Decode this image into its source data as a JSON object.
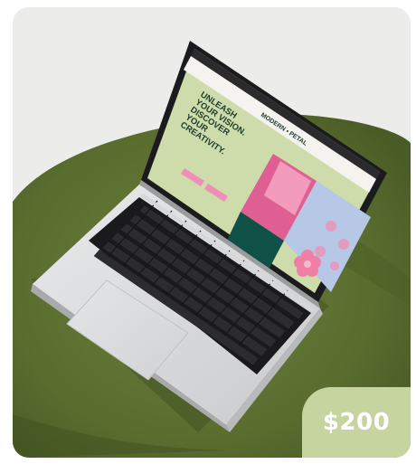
{
  "listing": {
    "price": "$200"
  },
  "website": {
    "brand": "MODERN • PETAL",
    "headline": [
      "UNLEASH",
      "YOUR VISION.",
      "DISCOVER",
      "YOUR",
      "CREATIVITY."
    ]
  },
  "colors": {
    "badge_bg": "#c6d59f",
    "badge_text": "#ffffff",
    "chair": "#5d7033",
    "site_bg": "#cddcaa",
    "accent_pink": "#f08fb5",
    "accent_teal": "#0f5147"
  },
  "icons": [
    "laptop-photo",
    "flower-icon"
  ]
}
